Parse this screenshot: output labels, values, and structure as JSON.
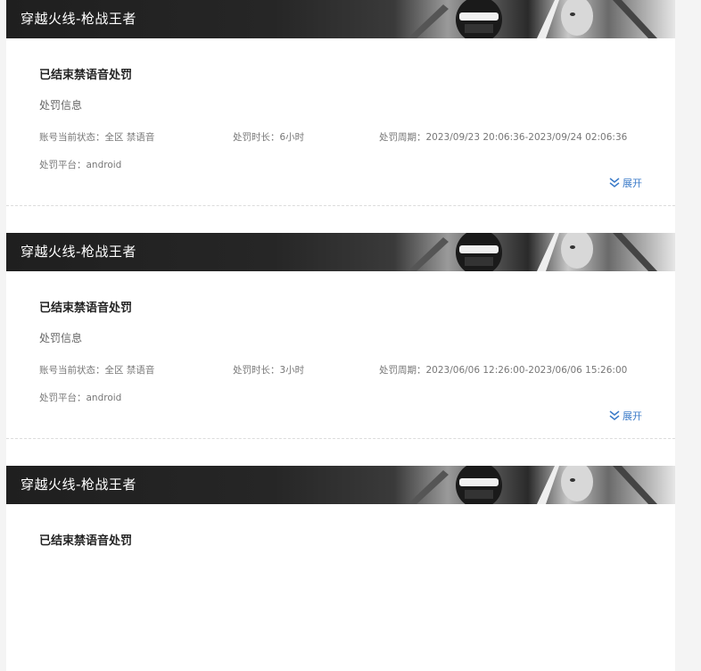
{
  "records": [
    {
      "game_title": "穿越火线-枪战王者",
      "status_title": "已结束禁语音处罚",
      "section_label": "处罚信息",
      "account_status": "账号当前状态：全区 禁语音",
      "duration": "处罚时长：6小时",
      "period": "处罚周期：2023/09/23 20:06:36-2023/09/24 02:06:36",
      "platform": "处罚平台：android",
      "expand_label": "展开"
    },
    {
      "game_title": "穿越火线-枪战王者",
      "status_title": "已结束禁语音处罚",
      "section_label": "处罚信息",
      "account_status": "账号当前状态：全区 禁语音",
      "duration": "处罚时长：3小时",
      "period": "处罚周期：2023/06/06 12:26:00-2023/06/06 15:26:00",
      "platform": "处罚平台：android",
      "expand_label": "展开"
    },
    {
      "game_title": "穿越火线-枪战王者",
      "status_title": "已结束禁语音处罚"
    }
  ],
  "icons": {
    "expand": "double-chevron-down-icon"
  },
  "colors": {
    "link": "#3a7ac8",
    "banner_dark": "#1f1f1f"
  }
}
